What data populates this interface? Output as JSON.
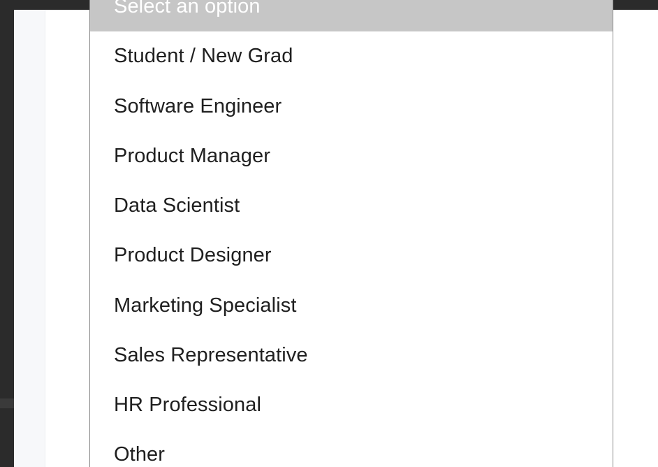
{
  "dropdown": {
    "placeholder": "Select an option",
    "options": [
      "Student / New Grad",
      "Software Engineer",
      "Product Manager",
      "Data Scientist",
      "Product Designer",
      "Marketing Specialist",
      "Sales Representative",
      "HR Professional",
      "Other"
    ],
    "highlighted_color": "#c6c6c6"
  }
}
